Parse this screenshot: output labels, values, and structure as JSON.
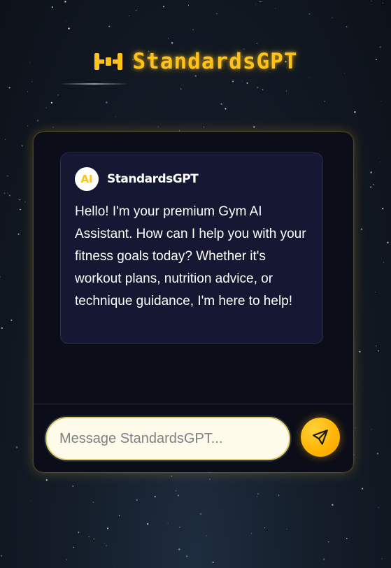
{
  "header": {
    "logo_text": "StandardsGPT",
    "logo_icon": "dumbbell-icon",
    "accent_color": "#ffc21a"
  },
  "chat": {
    "messages": [
      {
        "avatar_label": "AI",
        "sender": "StandardsGPT",
        "text": "Hello! I'm your premium Gym AI Assistant. How can I help you with your fitness goals today? Whether it's workout plans, nutrition advice, or technique guidance, I'm here to help!"
      }
    ]
  },
  "composer": {
    "placeholder": "Message StandardsGPT...",
    "send_icon": "send-icon"
  }
}
